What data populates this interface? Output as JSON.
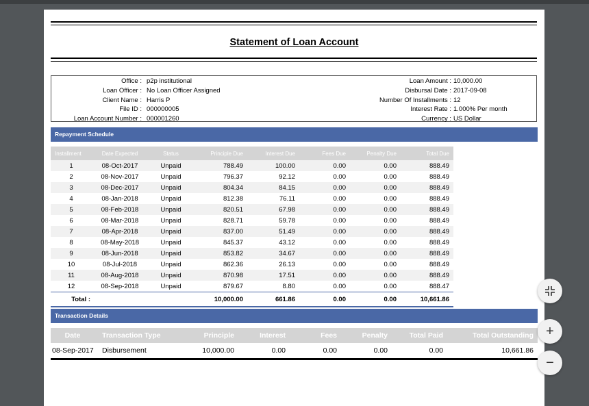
{
  "document": {
    "title": "Statement of Loan Account",
    "client_info": [
      {
        "label": "Office :",
        "value": "p2p institutional"
      },
      {
        "label": "Loan Officer :",
        "value": "No Loan Officer Assigned"
      },
      {
        "label": "Client Name :",
        "value": "Harris P"
      },
      {
        "label": "File ID :",
        "value": "000000005"
      },
      {
        "label": "Loan Account Number :",
        "value": "000001260"
      }
    ],
    "loan_info": [
      {
        "label": "Loan Amount :",
        "value": "10,000.00"
      },
      {
        "label": "Disbursal Date :",
        "value": "2017-09-08"
      },
      {
        "label": "Number Of Installments :",
        "value": "12"
      },
      {
        "label": "Interest Rate :",
        "value": "1.000% Per month"
      },
      {
        "label": "Currency :",
        "value": "US Dollar"
      }
    ],
    "repayment": {
      "heading": "Repayment Schedule",
      "columns": [
        "Installment",
        "Date Expected",
        "Status",
        "Principle Due",
        "Interest Due",
        "Fees Due",
        "Penalty Due",
        "Total Due"
      ],
      "rows": [
        [
          "1",
          "08-Oct-2017",
          "Unpaid",
          "788.49",
          "100.00",
          "0.00",
          "0.00",
          "888.49"
        ],
        [
          "2",
          "08-Nov-2017",
          "Unpaid",
          "796.37",
          "92.12",
          "0.00",
          "0.00",
          "888.49"
        ],
        [
          "3",
          "08-Dec-2017",
          "Unpaid",
          "804.34",
          "84.15",
          "0.00",
          "0.00",
          "888.49"
        ],
        [
          "4",
          "08-Jan-2018",
          "Unpaid",
          "812.38",
          "76.11",
          "0.00",
          "0.00",
          "888.49"
        ],
        [
          "5",
          "08-Feb-2018",
          "Unpaid",
          "820.51",
          "67.98",
          "0.00",
          "0.00",
          "888.49"
        ],
        [
          "6",
          "08-Mar-2018",
          "Unpaid",
          "828.71",
          "59.78",
          "0.00",
          "0.00",
          "888.49"
        ],
        [
          "7",
          "08-Apr-2018",
          "Unpaid",
          "837.00",
          "51.49",
          "0.00",
          "0.00",
          "888.49"
        ],
        [
          "8",
          "08-May-2018",
          "Unpaid",
          "845.37",
          "43.12",
          "0.00",
          "0.00",
          "888.49"
        ],
        [
          "9",
          "08-Jun-2018",
          "Unpaid",
          "853.82",
          "34.67",
          "0.00",
          "0.00",
          "888.49"
        ],
        [
          "10",
          "08-Jul-2018",
          "Unpaid",
          "862.36",
          "26.13",
          "0.00",
          "0.00",
          "888.49"
        ],
        [
          "11",
          "08-Aug-2018",
          "Unpaid",
          "870.98",
          "17.51",
          "0.00",
          "0.00",
          "888.49"
        ],
        [
          "12",
          "08-Sep-2018",
          "Unpaid",
          "879.67",
          "8.80",
          "0.00",
          "0.00",
          "888.47"
        ]
      ],
      "total": {
        "label": "Total :",
        "principle": "10,000.00",
        "interest": "661.86",
        "fees": "0.00",
        "penalty": "0.00",
        "total": "10,661.86"
      }
    },
    "transactions": {
      "heading": "Transaction Details",
      "columns": [
        "Date",
        "Transaction Type",
        "Principle",
        "Interest",
        "Fees",
        "Penalty",
        "Total Paid",
        "Total Outstanding"
      ],
      "rows": [
        [
          "08-Sep-2017",
          "Disbursement",
          "10,000.00",
          "0.00",
          "0.00",
          "0.00",
          "0.00",
          "10,661.86"
        ]
      ]
    }
  },
  "viewer_controls": {
    "fit_icon": "compress-icon",
    "zoom_in_label": "+",
    "zoom_out_label": "−"
  },
  "colors": {
    "section_bar": "#4a68a6",
    "header_bg": "#d4d4d4",
    "viewer_bg": "#525659"
  }
}
